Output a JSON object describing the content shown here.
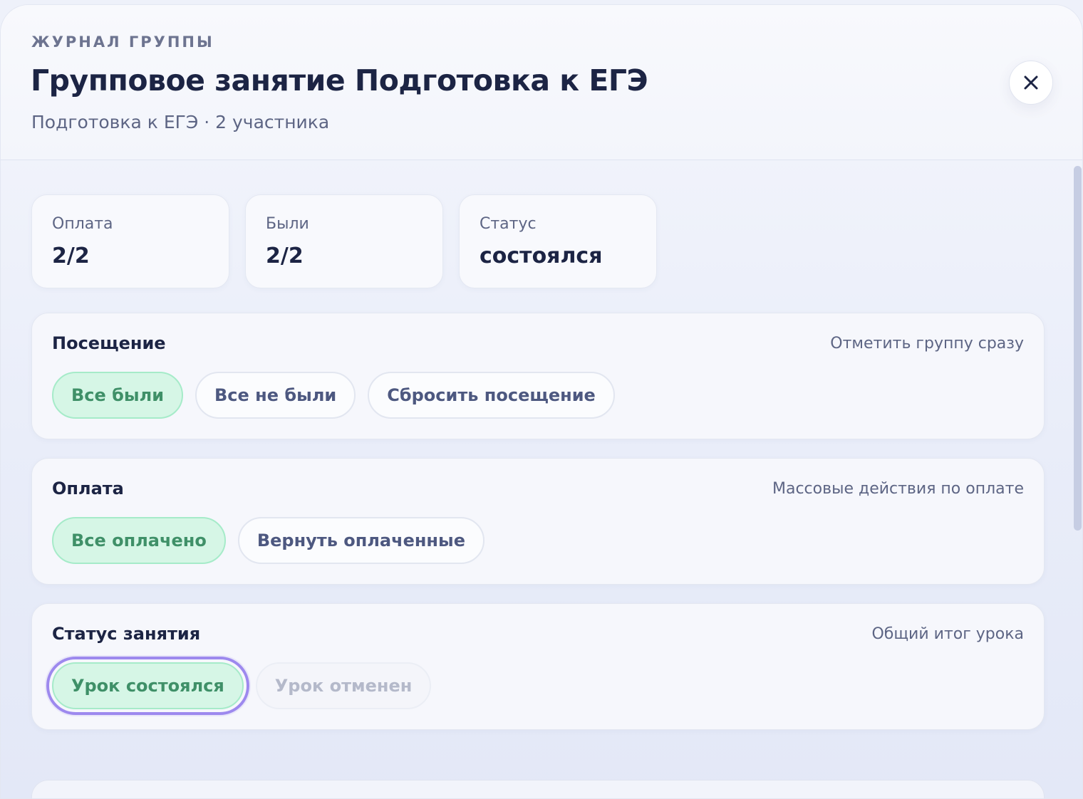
{
  "header": {
    "eyebrow": "ЖУРНАЛ ГРУППЫ",
    "title": "Групповое занятие Подготовка к ЕГЭ",
    "subtitle": "Подготовка к ЕГЭ · 2 участника",
    "close_icon": "close-icon"
  },
  "stats": [
    {
      "label": "Оплата",
      "value": "2/2"
    },
    {
      "label": "Были",
      "value": "2/2"
    },
    {
      "label": "Статус",
      "value": "состоялся"
    }
  ],
  "attendance": {
    "title": "Посещение",
    "hint": "Отметить группу сразу",
    "buttons": [
      "Все были",
      "Все не были",
      "Сбросить посещение"
    ]
  },
  "payment": {
    "title": "Оплата",
    "hint": "Массовые действия по оплате",
    "buttons": [
      "Все оплачено",
      "Вернуть оплаченные"
    ]
  },
  "lesson_status": {
    "title": "Статус занятия",
    "hint": "Общий итог урока",
    "buttons": [
      "Урок состоялся",
      "Урок отменен"
    ]
  },
  "colors": {
    "accent_green_text": "#3f9068",
    "accent_green_bg": "#d6f6e6",
    "focus_ring": "#9d89ee",
    "title_text": "#1c2444"
  }
}
